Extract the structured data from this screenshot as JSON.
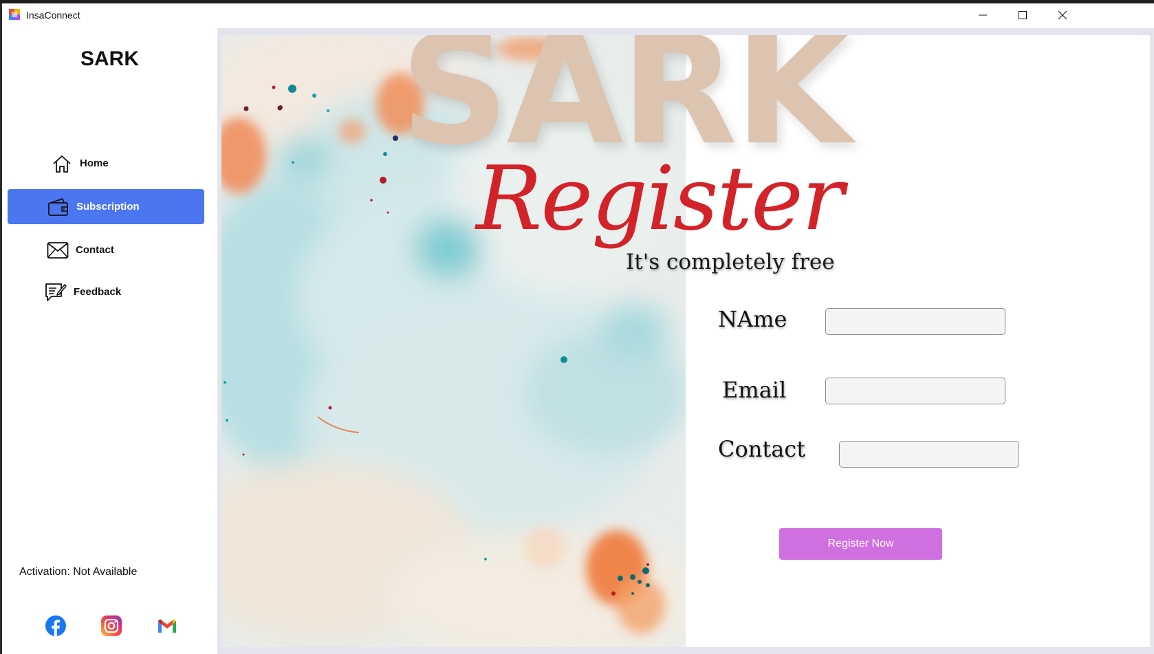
{
  "window": {
    "title": "InsaConnect",
    "app_icon": "insaconnect-app-icon",
    "controls": [
      "minimize-icon",
      "maximize-icon",
      "close-icon"
    ]
  },
  "sidebar": {
    "brand": "SARK",
    "items": [
      {
        "label": "Home",
        "icon": "home-icon",
        "active": false
      },
      {
        "label": "Subscription",
        "icon": "wallet-icon",
        "active": true
      },
      {
        "label": "Contact",
        "icon": "envelope-icon",
        "active": false
      },
      {
        "label": "Feedback",
        "icon": "feedback-icon",
        "active": false
      }
    ],
    "activation": "Activation: Not Available",
    "social": [
      "facebook-icon",
      "instagram-icon",
      "gmail-icon"
    ]
  },
  "poster": {
    "brand": "SARK",
    "headline": "Register",
    "tagline": "It's completely free"
  },
  "form": {
    "name_label": "NAme",
    "email_label": "Email",
    "contact_label": "Contact",
    "name_value": "",
    "email_value": "",
    "contact_value": "",
    "submit_label": "Register Now"
  },
  "colors": {
    "nav_active": "#4a76f0",
    "submit_button": "#d06fe0",
    "brand_watermark": "#dcc4b0",
    "headline": "#d3232a"
  }
}
